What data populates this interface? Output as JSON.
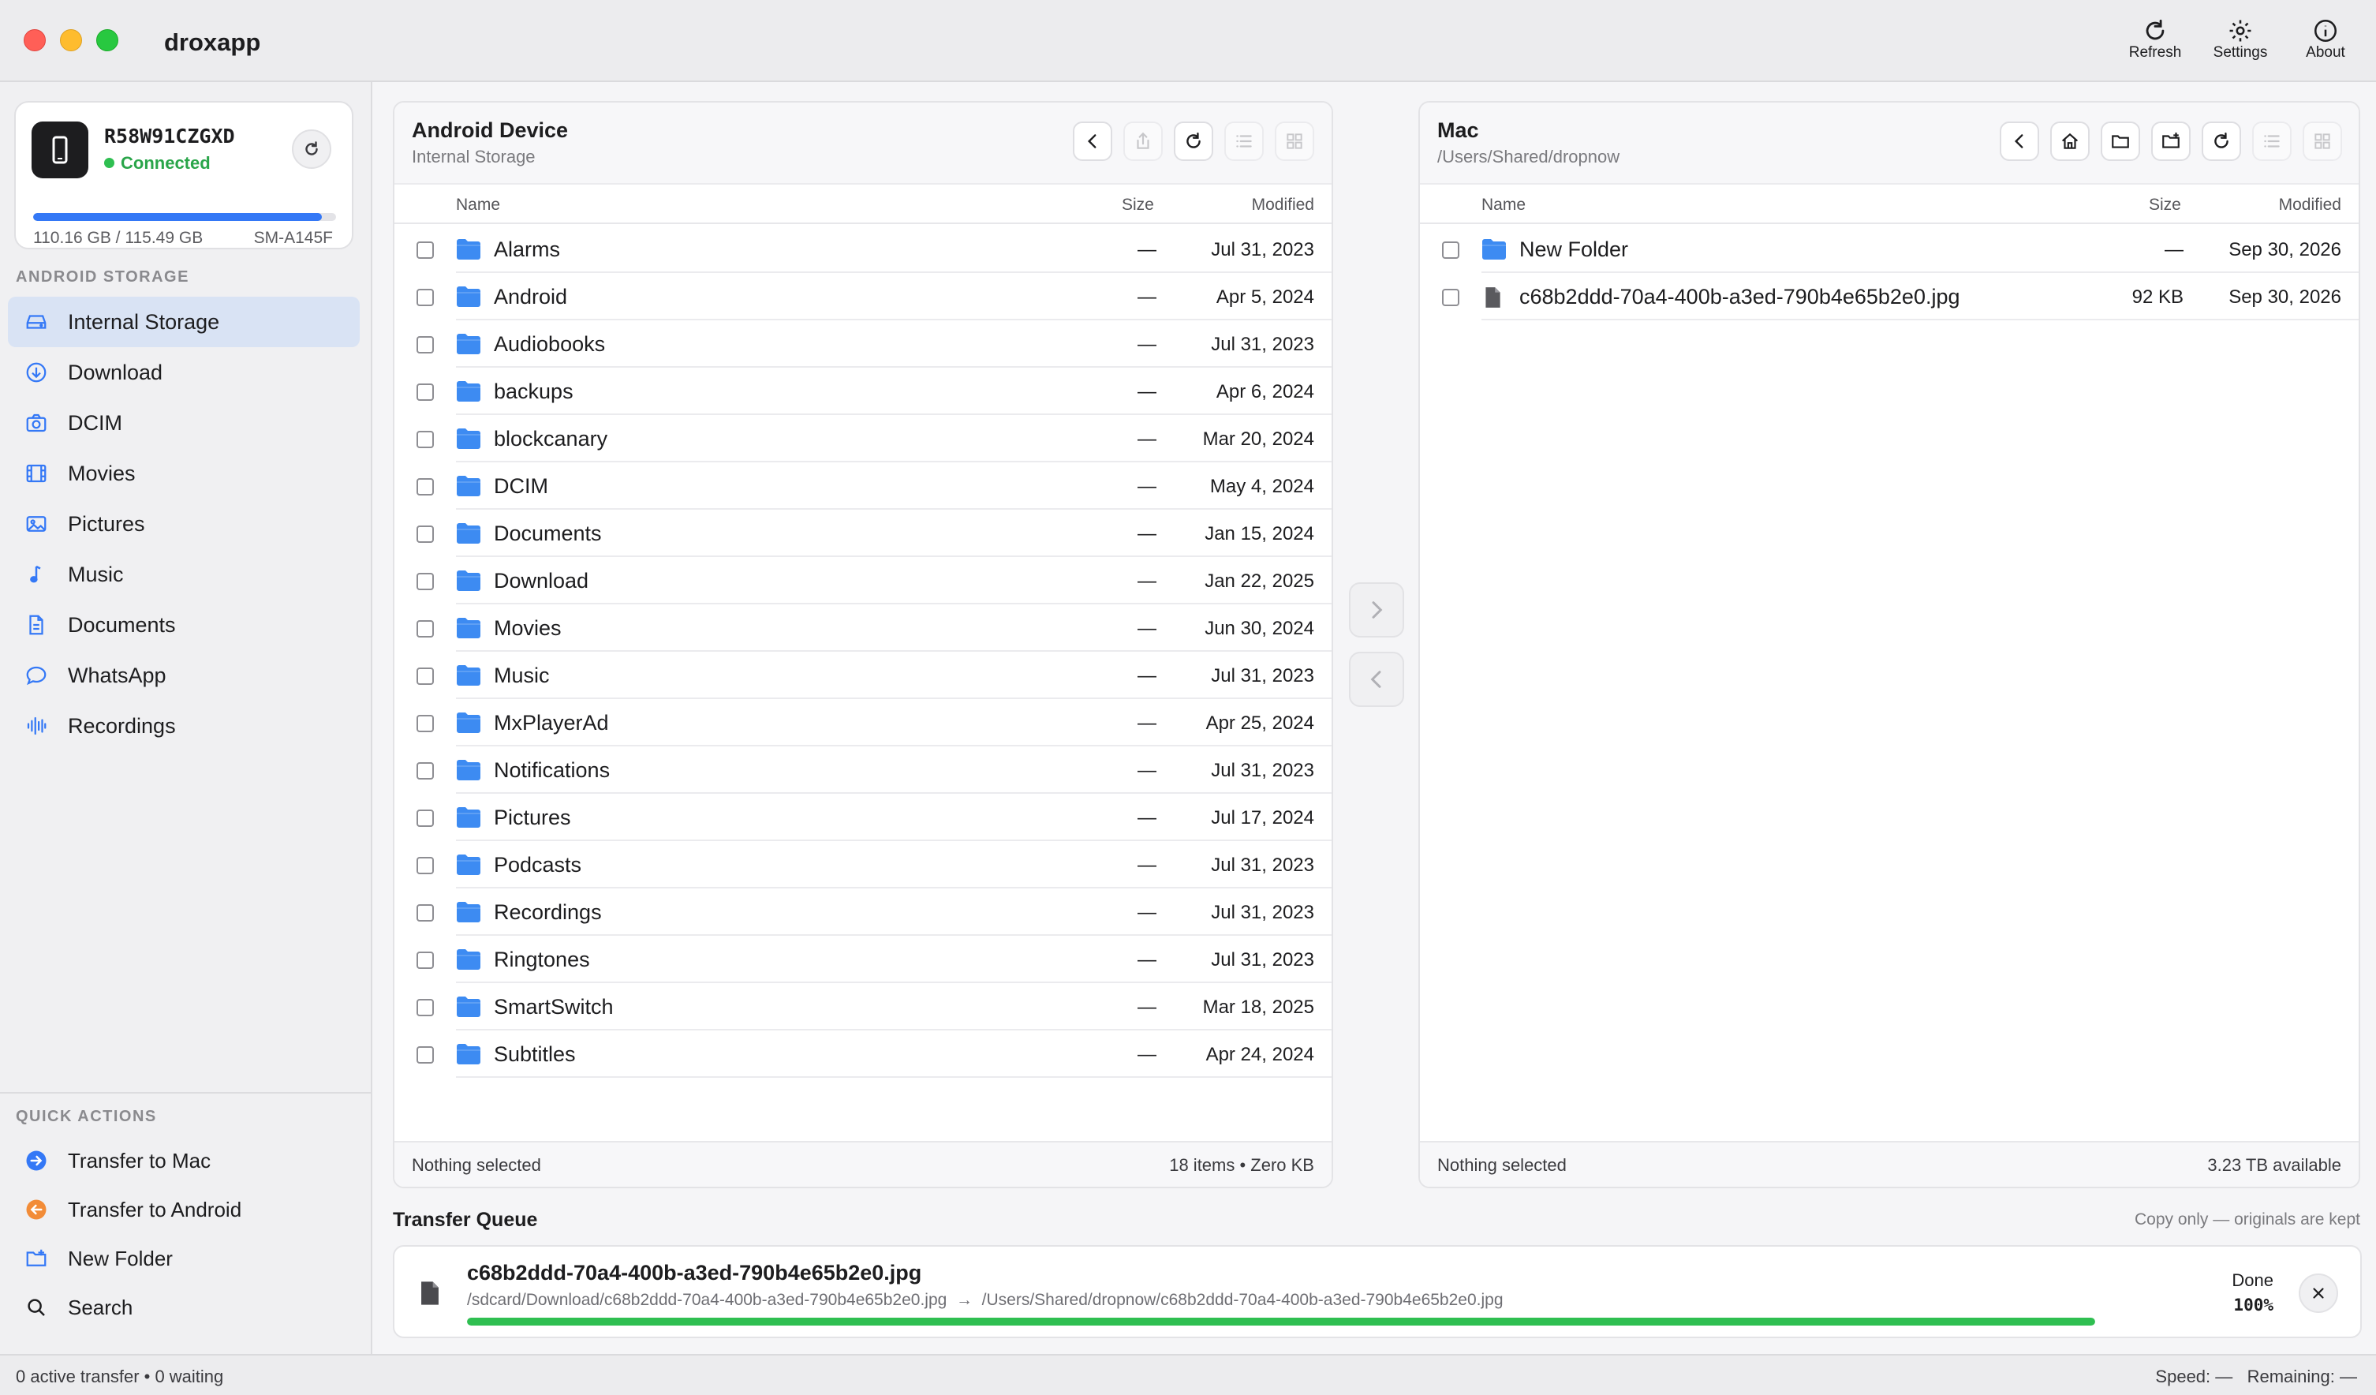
{
  "app": {
    "title": "droxapp",
    "toolbar": {
      "refresh_label": "Refresh",
      "settings_label": "Settings",
      "about_label": "About"
    }
  },
  "device": {
    "serial": "R58W91CZGXD",
    "status": "Connected",
    "storage_used_fraction": 0.954,
    "storage_text": "110.16 GB / 115.49 GB",
    "model": "SM-A145F"
  },
  "sidebar": {
    "storage_section_title": "ANDROID STORAGE",
    "items": [
      {
        "label": "Internal Storage",
        "icon": "drive-icon",
        "active": true
      },
      {
        "label": "Download",
        "icon": "download-circle-icon"
      },
      {
        "label": "DCIM",
        "icon": "camera-icon"
      },
      {
        "label": "Movies",
        "icon": "film-icon"
      },
      {
        "label": "Pictures",
        "icon": "photo-icon"
      },
      {
        "label": "Music",
        "icon": "music-note-icon"
      },
      {
        "label": "Documents",
        "icon": "document-icon"
      },
      {
        "label": "WhatsApp",
        "icon": "chat-bubble-icon"
      },
      {
        "label": "Recordings",
        "icon": "waveform-icon"
      }
    ],
    "quick_actions_title": "QUICK ACTIONS",
    "quick_actions": [
      {
        "label": "Transfer to Mac",
        "icon": "arrow-right-circle-icon"
      },
      {
        "label": "Transfer to Android",
        "icon": "arrow-left-circle-icon"
      },
      {
        "label": "New Folder",
        "icon": "folder-plus-icon"
      },
      {
        "label": "Search",
        "icon": "search-icon"
      }
    ]
  },
  "android_pane": {
    "title": "Android Device",
    "subtitle": "Internal Storage",
    "columns": {
      "name": "Name",
      "size": "Size",
      "modified": "Modified"
    },
    "rows": [
      {
        "name": "Alarms",
        "size": "—",
        "modified": "Jul 31, 2023"
      },
      {
        "name": "Android",
        "size": "—",
        "modified": "Apr 5, 2024"
      },
      {
        "name": "Audiobooks",
        "size": "—",
        "modified": "Jul 31, 2023"
      },
      {
        "name": "backups",
        "size": "—",
        "modified": "Apr 6, 2024"
      },
      {
        "name": "blockcanary",
        "size": "—",
        "modified": "Mar 20, 2024"
      },
      {
        "name": "DCIM",
        "size": "—",
        "modified": "May 4, 2024"
      },
      {
        "name": "Documents",
        "size": "—",
        "modified": "Jan 15, 2024"
      },
      {
        "name": "Download",
        "size": "—",
        "modified": "Jan 22, 2025"
      },
      {
        "name": "Movies",
        "size": "—",
        "modified": "Jun 30, 2024"
      },
      {
        "name": "Music",
        "size": "—",
        "modified": "Jul 31, 2023"
      },
      {
        "name": "MxPlayerAd",
        "size": "—",
        "modified": "Apr 25, 2024"
      },
      {
        "name": "Notifications",
        "size": "—",
        "modified": "Jul 31, 2023"
      },
      {
        "name": "Pictures",
        "size": "—",
        "modified": "Jul 17, 2024"
      },
      {
        "name": "Podcasts",
        "size": "—",
        "modified": "Jul 31, 2023"
      },
      {
        "name": "Recordings",
        "size": "—",
        "modified": "Jul 31, 2023"
      },
      {
        "name": "Ringtones",
        "size": "—",
        "modified": "Jul 31, 2023"
      },
      {
        "name": "SmartSwitch",
        "size": "—",
        "modified": "Mar 18, 2025"
      },
      {
        "name": "Subtitles",
        "size": "—",
        "modified": "Apr 24, 2024"
      }
    ],
    "footer_left": "Nothing selected",
    "footer_right": "18 items • Zero KB"
  },
  "mac_pane": {
    "title": "Mac",
    "subtitle": "/Users/Shared/dropnow",
    "columns": {
      "name": "Name",
      "size": "Size",
      "modified": "Modified"
    },
    "rows": [
      {
        "name": "New Folder",
        "size": "—",
        "modified": "Sep 30, 2026",
        "type": "folder"
      },
      {
        "name": "c68b2ddd-70a4-400b-a3ed-790b4e65b2e0.jpg",
        "size": "92 KB",
        "modified": "Sep 30, 2026",
        "type": "file"
      }
    ],
    "footer_left": "Nothing selected",
    "footer_right": "3.23 TB available"
  },
  "queue": {
    "title": "Transfer Queue",
    "note": "Copy only — originals are kept",
    "item": {
      "name": "c68b2ddd-70a4-400b-a3ed-790b4e65b2e0.jpg",
      "source": "/sdcard/Download/c68b2ddd-70a4-400b-a3ed-790b4e65b2e0.jpg",
      "arrow": "→",
      "dest": "/Users/Shared/dropnow/c68b2ddd-70a4-400b-a3ed-790b4e65b2e0.jpg",
      "status": "Done",
      "percent_text": "100%",
      "progress": 1.0
    }
  },
  "statusbar": {
    "left": "0 active transfer • 0 waiting",
    "speed": "Speed: —",
    "remaining": "Remaining: —"
  },
  "colors": {
    "accent": "#3478f6",
    "folder": "#3d8bf2",
    "connected": "#2fbf51",
    "transfer_to_mac": "#3478f6",
    "transfer_to_android": "#f28c38"
  }
}
